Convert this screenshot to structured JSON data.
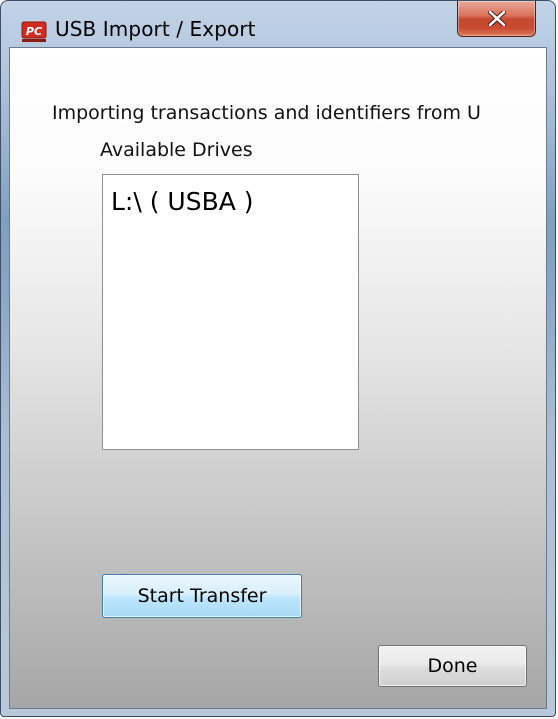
{
  "window": {
    "title": "USB Import / Export",
    "app_icon": "pc-logo-icon",
    "close_icon": "close-icon"
  },
  "content": {
    "heading": "Importing transactions and identifiers from U",
    "drives_label": "Available Drives",
    "drives": [
      "L:\\ ( USBA )"
    ],
    "start_button_label": "Start Transfer",
    "done_button_label": "Done"
  },
  "colors": {
    "close_button": "#c94a30",
    "start_button_accent": "#a7d9f5",
    "app_icon_red": "#d22b1f"
  }
}
